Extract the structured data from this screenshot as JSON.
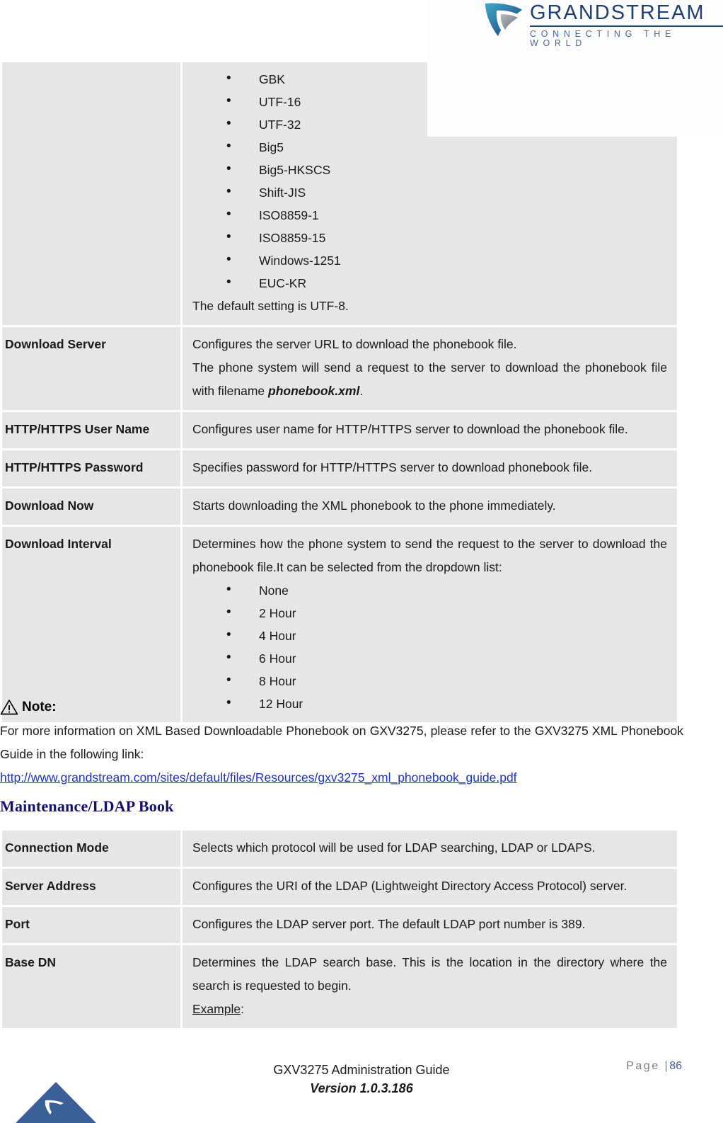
{
  "header": {
    "logo_word": "GRANDSTREAM",
    "logo_tagline": "CONNECTING THE WORLD",
    "logo_icon": "grandstream-arrow-logo"
  },
  "phonebook_table": {
    "encoding_row": {
      "key": "",
      "options": [
        "GBK",
        "UTF-16",
        "UTF-32",
        "Big5",
        "Big5-HKSCS",
        "Shift-JIS",
        "ISO8859-1",
        "ISO8859-15",
        "Windows-1251",
        "EUC-KR"
      ],
      "default_note": "The default setting is UTF-8."
    },
    "rows": [
      {
        "key": "Download Server",
        "lines": [
          "Configures the server URL to download the phonebook file.",
          "The phone system will send a request to the server to download the phonebook file with filename "
        ],
        "emphasis": "phonebook.xml",
        "tail": "."
      },
      {
        "key": "HTTP/HTTPS User Name",
        "text": "Configures user name for HTTP/HTTPS server to download the phonebook file."
      },
      {
        "key": "HTTP/HTTPS Password",
        "text": "Specifies password for HTTP/HTTPS server to download phonebook file."
      },
      {
        "key": "Download Now",
        "text": "Starts downloading the XML phonebook to the phone immediately."
      },
      {
        "key": "Download Interval",
        "text": "Determines how the phone system to send the request to the server to download the phonebook file.It can be selected from the dropdown list:",
        "options": [
          "None",
          "2 Hour",
          "4 Hour",
          "6 Hour",
          "8 Hour",
          "12 Hour"
        ]
      }
    ]
  },
  "note": {
    "icon": "warning-triangle-icon",
    "label": "Note:",
    "body": "For more information on XML Based Downloadable Phonebook on GXV3275, please refer to the GXV3275 XML Phonebook Guide in the following link:",
    "link": "http://www.grandstream.com/sites/default/files/Resources/gxv3275_xml_phonebook_guide.pdf"
  },
  "section_heading": "Maintenance/LDAP Book",
  "ldap_table": {
    "rows": [
      {
        "key": "Connection Mode",
        "text": "Selects which protocol will be used for LDAP searching, LDAP or LDAPS."
      },
      {
        "key": "Server Address",
        "text": "Configures the URI of the LDAP (Lightweight Directory Access Protocol) server."
      },
      {
        "key": "Port",
        "text": "Configures the LDAP server port. The default LDAP port number is 389."
      },
      {
        "key": "Base DN",
        "text": "Determines the LDAP search base. This is the location in the directory where the search is requested to begin.",
        "example_label": "Example",
        "example_colon": ":"
      }
    ]
  },
  "footer": {
    "page_word": "Page  |",
    "page_number": "86",
    "doc_title": "GXV3275 Administration Guide",
    "doc_version": "Version 1.0.3.186",
    "logo_icon": "grandstream-triangle-logo"
  },
  "colors": {
    "cell_bg": "#e6e6e6",
    "heading_navy": "#13126b",
    "link_blue": "#1b32c8",
    "logo_navy": "#1f3f71",
    "footer_triangle": "#3a5f96"
  }
}
